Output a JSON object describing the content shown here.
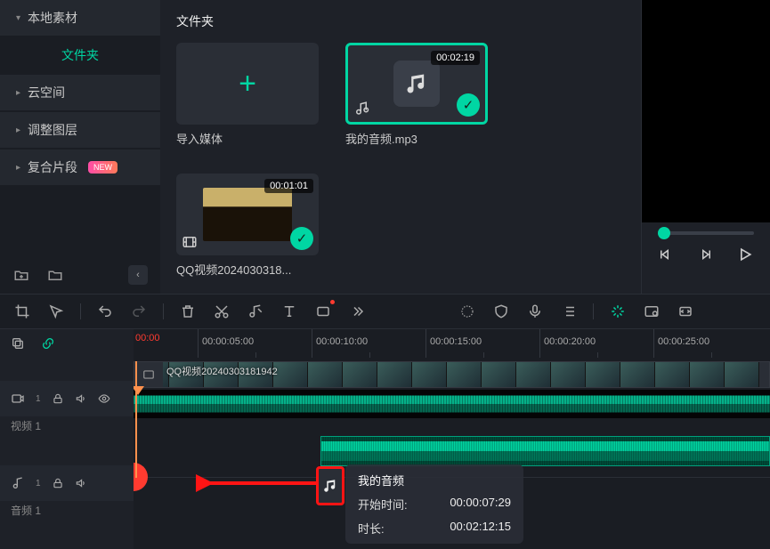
{
  "sidebar": {
    "items": [
      {
        "label": "本地素材",
        "expanded": true
      },
      {
        "label": "文件夹",
        "active": true
      },
      {
        "label": "云空间"
      },
      {
        "label": "调整图层"
      },
      {
        "label": "复合片段",
        "badge": "NEW"
      }
    ]
  },
  "media": {
    "heading": "文件夹",
    "import_label": "导入媒体",
    "clips": [
      {
        "name": "我的音频.mp3",
        "duration": "00:02:19",
        "type": "audio",
        "selected": true,
        "checked": true
      },
      {
        "name": "QQ视频2024030318...",
        "duration": "00:01:01",
        "type": "video",
        "checked": true
      }
    ]
  },
  "toolbar": {
    "icons": [
      "crop-tool",
      "cursor-tool",
      "undo",
      "redo",
      "delete",
      "cut",
      "audio-beat",
      "text",
      "rect",
      "more",
      "smart",
      "shield",
      "mic",
      "list",
      "ai-cut",
      "frame-export",
      "fit"
    ]
  },
  "timeline": {
    "ruler": [
      "00:00",
      "00:00:05:00",
      "00:00:10:00",
      "00:00:15:00",
      "00:00:20:00",
      "00:00:25:00"
    ],
    "video_track": {
      "label": "视频 1",
      "count": "1",
      "clip_title": "QQ视频20240303181942"
    },
    "audio_track": {
      "label": "音频 1",
      "count": "1"
    },
    "drag": {
      "title": "我的音频",
      "start_label": "开始时间:",
      "start_value": "00:00:07:29",
      "dur_label": "时长:",
      "dur_value": "00:02:12:15"
    }
  }
}
